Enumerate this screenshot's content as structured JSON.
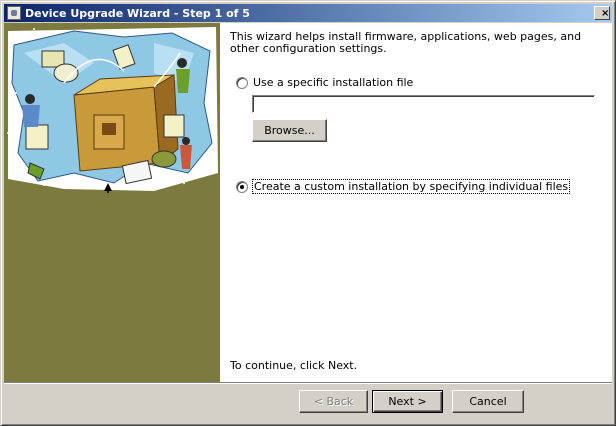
{
  "window": {
    "title": "Device Upgrade Wizard - Step 1 of 5",
    "close_label": "×"
  },
  "colors": {
    "side_panel": "#7c7a3f",
    "title_bar_start": "#0a246a",
    "title_bar_end": "#a6caf0",
    "dialog_face": "#d4d0c8"
  },
  "main": {
    "intro": "This wizard helps install firmware, applications, web pages, and other configuration settings.",
    "option_file": {
      "label": "Use a specific installation file",
      "selected": false
    },
    "file_input": {
      "value": "",
      "placeholder": ""
    },
    "browse_label": "Browse...",
    "option_custom": {
      "label": "Create a custom installation by specifying individual files",
      "selected": true
    },
    "continue_text": "To continue, click Next."
  },
  "footer": {
    "back_label": "< Back",
    "next_label": "Next >",
    "cancel_label": "Cancel"
  }
}
